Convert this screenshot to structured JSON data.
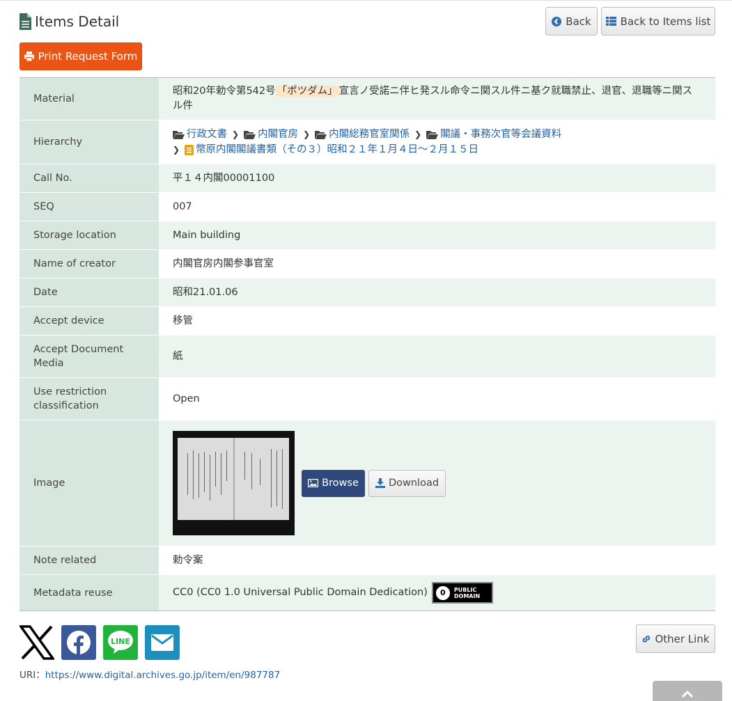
{
  "header": {
    "title": "Items Detail",
    "back_label": "Back",
    "back_list_label": "Back to Items list",
    "print_label": "Print Request Form"
  },
  "details": {
    "material": {
      "label": "Material",
      "value_pre": "昭和20年勅令第542号",
      "value_hl": "「ポツダム」",
      "value_post": "宣言ノ受諾ニ伴ヒ発スル命令ニ関スル件ニ基ク就職禁止、退官、退職等ニ関スル件"
    },
    "hierarchy": {
      "label": "Hierarchy",
      "crumbs": [
        "行政文書",
        "内閣官房",
        "内閣総務官室関係",
        "閣議・事務次官等会議資料"
      ],
      "file": "幣原内閣閣議書類（その３）昭和２１年１月４日～２月１５日"
    },
    "call_no": {
      "label": "Call No.",
      "value": "平１４内閣00001100"
    },
    "seq": {
      "label": "SEQ",
      "value": "007"
    },
    "storage": {
      "label": "Storage location",
      "value": "Main building"
    },
    "creator": {
      "label": "Name of creator",
      "value": "内閣官房内閣参事官室"
    },
    "date": {
      "label": "Date",
      "value": "昭和21.01.06"
    },
    "accept_device": {
      "label": "Accept device",
      "value": "移管"
    },
    "accept_media": {
      "label": "Accept Document Media",
      "value": "紙"
    },
    "use_restriction": {
      "label": "Use restriction classification",
      "value": "Open"
    },
    "image": {
      "label": "Image",
      "browse_label": "Browse",
      "download_label": "Download"
    },
    "note": {
      "label": "Note related",
      "value": "勅令案"
    },
    "metadata_reuse": {
      "label": "Metadata reuse",
      "value": "CC0 (CC0 1.0 Universal Public Domain Dedication)",
      "badge_line1": "PUBLIC",
      "badge_line2": "DOMAIN",
      "badge_zero": "0"
    }
  },
  "footer": {
    "other_link_label": "Other Link",
    "uri_label": "URI：",
    "uri_value": "https://www.digital.archives.go.jp/item/en/987787"
  },
  "colors": {
    "print_button": "#ea5414",
    "browse_button": "#30497c",
    "label_cell": "#d7e7df",
    "value_cell_alt": "#ebf4ef",
    "link": "#2262a8"
  }
}
